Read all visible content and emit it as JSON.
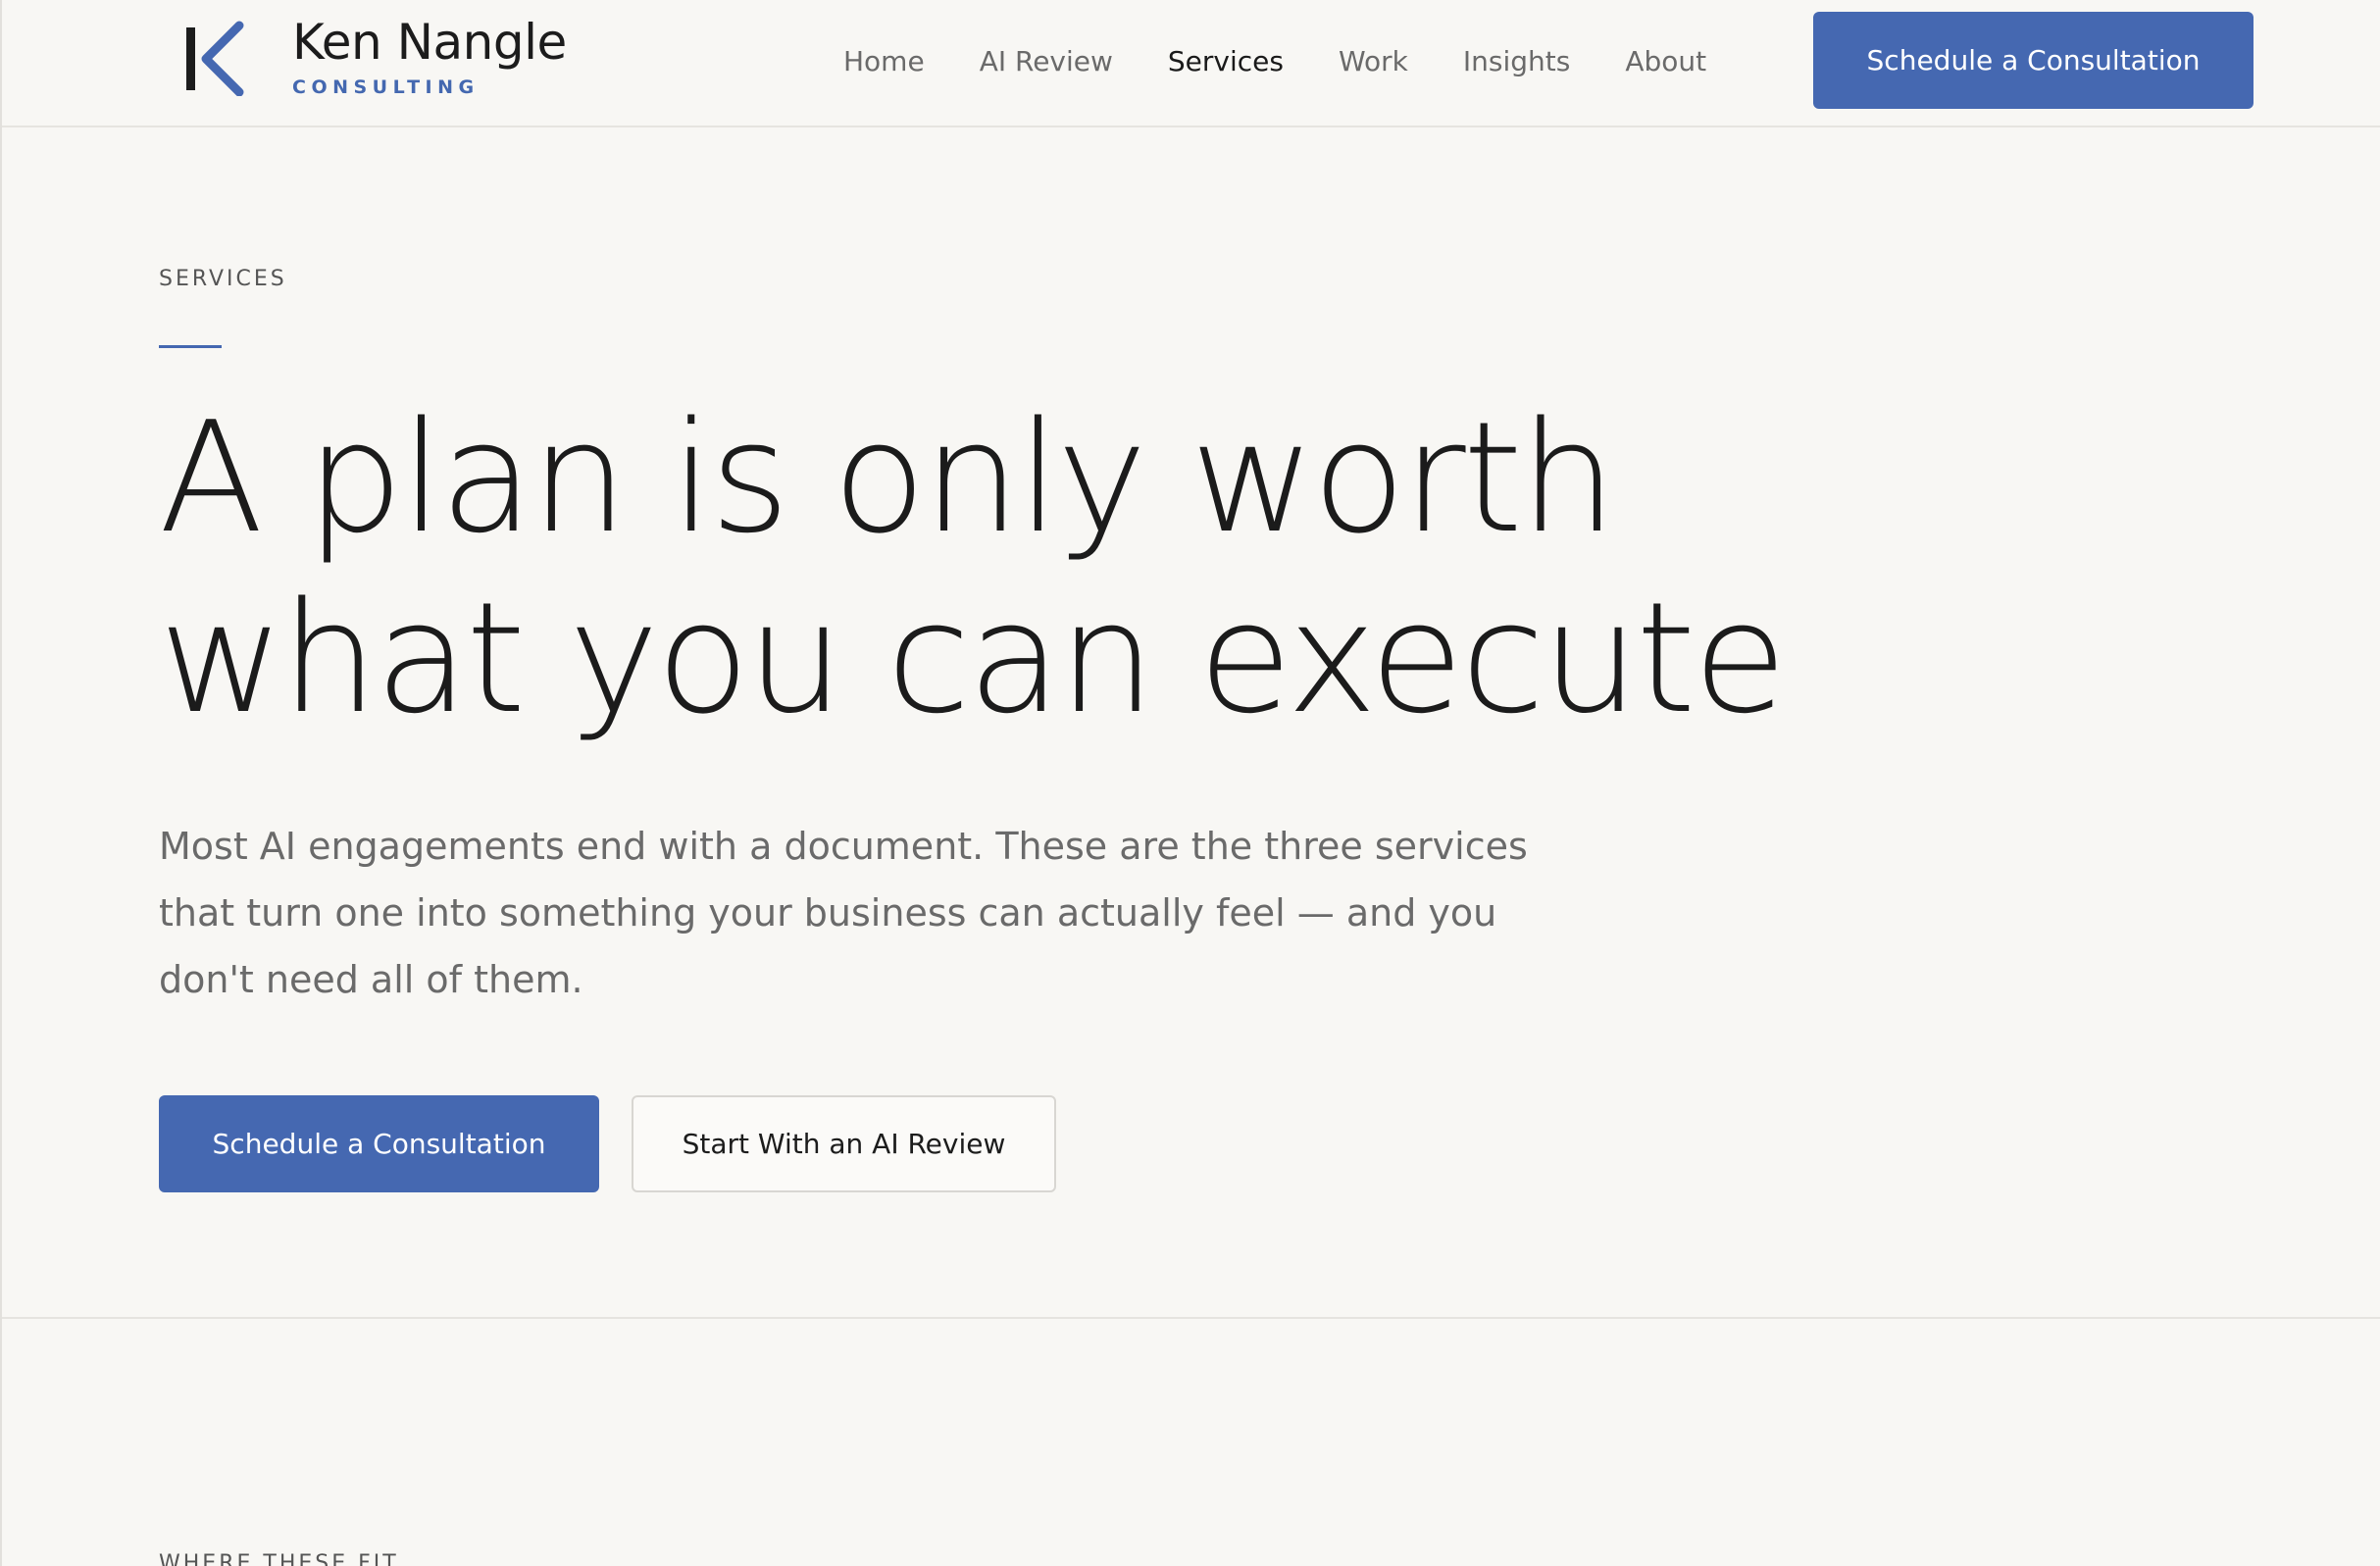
{
  "brand": {
    "mark": "K",
    "name": "Ken Nangle",
    "subtitle": "CONSULTING",
    "accent_color": "#4568b1"
  },
  "nav": {
    "items": [
      {
        "label": "Home",
        "active": false
      },
      {
        "label": "AI Review",
        "active": false
      },
      {
        "label": "Services",
        "active": true
      },
      {
        "label": "Work",
        "active": false
      },
      {
        "label": "Insights",
        "active": false
      },
      {
        "label": "About",
        "active": false
      }
    ],
    "cta_label": "Schedule a Consultation"
  },
  "hero": {
    "eyebrow": "SERVICES",
    "headline_line1": "A plan is only worth",
    "headline_line2": "what you can execute",
    "lede": "Most AI engagements end with a document. These are the three services that turn one into something your business can actually feel — and you don't need all of them.",
    "primary_cta": "Schedule a Consultation",
    "secondary_cta": "Start With an AI Review"
  },
  "next_section": {
    "eyebrow": "WHERE THESE FIT"
  }
}
